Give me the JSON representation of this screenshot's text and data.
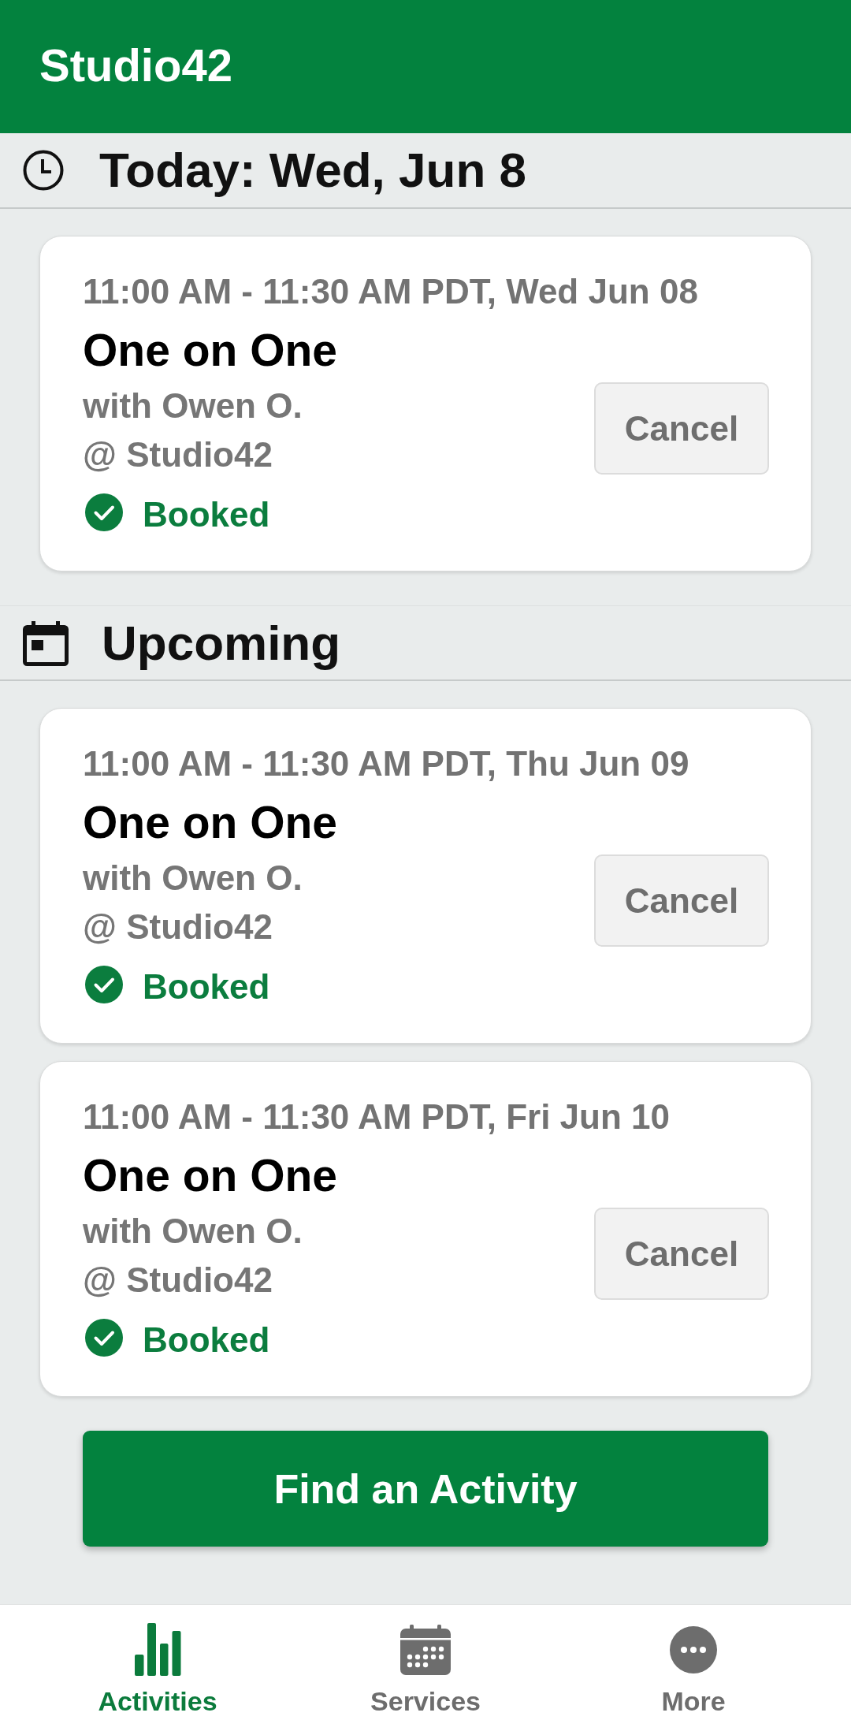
{
  "app_bar": {
    "title": "Studio42"
  },
  "sections": [
    {
      "kind": "today",
      "title": "Today: Wed, Jun 8",
      "bookings": [
        {
          "time": "11:00 AM - 11:30 AM PDT, Wed Jun 08",
          "title": "One on One",
          "instructor": "with Owen O.",
          "location": "@ Studio42",
          "status": "Booked",
          "action": "Cancel"
        }
      ]
    },
    {
      "kind": "upcoming",
      "title": "Upcoming",
      "bookings": [
        {
          "time": "11:00 AM - 11:30 AM PDT, Thu Jun 09",
          "title": "One on One",
          "instructor": "with Owen O.",
          "location": "@ Studio42",
          "status": "Booked",
          "action": "Cancel"
        },
        {
          "time": "11:00 AM - 11:30 AM PDT, Fri Jun 10",
          "title": "One on One",
          "instructor": "with Owen O.",
          "location": "@ Studio42",
          "status": "Booked",
          "action": "Cancel"
        }
      ]
    }
  ],
  "find_button": {
    "label": "Find an Activity"
  },
  "bottom_nav": [
    {
      "kind": "activities",
      "label": "Activities",
      "selected": true
    },
    {
      "kind": "services",
      "label": "Services",
      "selected": false
    },
    {
      "kind": "more",
      "label": "More",
      "selected": false
    }
  ]
}
